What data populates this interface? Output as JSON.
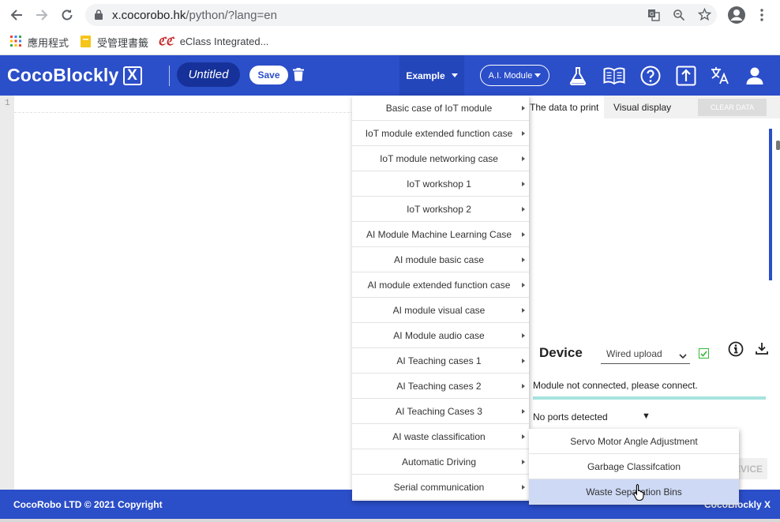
{
  "browser": {
    "url_host": "x.cocorobo.hk",
    "url_path": "/python/?lang=en",
    "bookmarks": [
      {
        "label": "應用程式"
      },
      {
        "label": "受管理書籤"
      },
      {
        "label": "eClass Integrated..."
      }
    ]
  },
  "header": {
    "logo_text": "CocoBlockly",
    "logo_x": "X",
    "project_title": "Untitled",
    "save_label": "Save",
    "example_label": "Example",
    "ai_module_label": "A.I. Module",
    "icons": [
      "flask-icon",
      "book-icon",
      "help-icon",
      "upload-icon",
      "translate-icon",
      "user-icon"
    ]
  },
  "editor": {
    "line_number": "1"
  },
  "output_panel": {
    "tab_print": "The data to print",
    "tab_visual": "Visual display",
    "clear_label": "CLEAR DATA"
  },
  "device": {
    "title": "Device",
    "upload_mode": "Wired upload",
    "status": "Module not connected, please connect.",
    "ports": "No ports detected",
    "ports_arrow": "▼",
    "button_partial": "EVICE"
  },
  "example_menu": {
    "items": [
      "Basic case of IoT module",
      "IoT module extended function case",
      "IoT module networking case",
      "IoT workshop 1",
      "IoT workshop 2",
      "AI Module Machine Learning Case",
      "AI module basic case",
      "AI module extended function case",
      "AI module visual case",
      "AI Module audio case",
      "AI Teaching cases 1",
      "AI Teaching cases 2",
      "AI Teaching Cases 3",
      "AI waste classification",
      "Automatic Driving",
      "Serial communication"
    ]
  },
  "submenu": {
    "items": [
      "Servo Motor Angle Adjustment",
      "Garbage Classifcation",
      "Waste Separation Bins"
    ],
    "active_index": 2
  },
  "footer": {
    "copyright": "CocoRobo LTD © 2021 Copyright",
    "brand": "CocoBlockly X"
  },
  "colors": {
    "primary": "#2b4ec9",
    "title_pill": "#163199",
    "submenu_active": "#cdd9f5"
  }
}
